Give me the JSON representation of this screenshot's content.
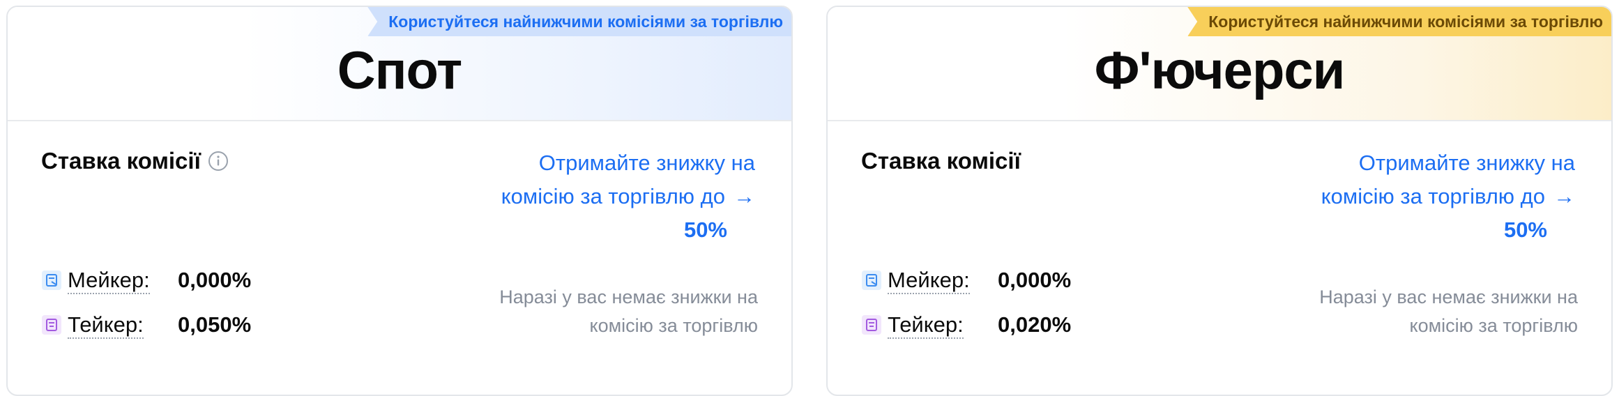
{
  "cards": [
    {
      "ribbon": "Користуйтеся найнижчими комісіями за торгівлю",
      "title": "Спот",
      "rate_label": "Ставка комісії",
      "promo_line1": "Отримайте знижку на",
      "promo_line2": "комісію за торгівлю до",
      "promo_arrow": "→",
      "promo_pct": "50%",
      "maker_label": "Мейкер:",
      "maker_value": "0,000%",
      "taker_label": "Тейкер:",
      "taker_value": "0,050%",
      "note_line1": "Наразі у вас немає знижки на",
      "note_line2": "комісію за торгівлю"
    },
    {
      "ribbon": "Користуйтеся найнижчими комісіями за торгівлю",
      "title": "Ф'ючерси",
      "rate_label": "Ставка комісії",
      "promo_line1": "Отримайте знижку на",
      "promo_line2": "комісію за торгівлю до",
      "promo_arrow": "→",
      "promo_pct": "50%",
      "maker_label": "Мейкер:",
      "maker_value": "0,000%",
      "taker_label": "Тейкер:",
      "taker_value": "0,020%",
      "note_line1": "Наразі у вас немає знижки на",
      "note_line2": "комісію за торгівлю"
    }
  ],
  "colors": {
    "link_blue": "#1c6ef2",
    "spot_ribbon_bg": "#cfe0fc",
    "futures_ribbon_bg": "#f8cf5a",
    "maker_icon": "#3b8cf0",
    "taker_icon": "#a35be0",
    "muted_text": "#858c98"
  },
  "icons": {
    "info": "info-circle-icon",
    "maker": "maker-order-icon",
    "taker": "taker-order-icon"
  }
}
